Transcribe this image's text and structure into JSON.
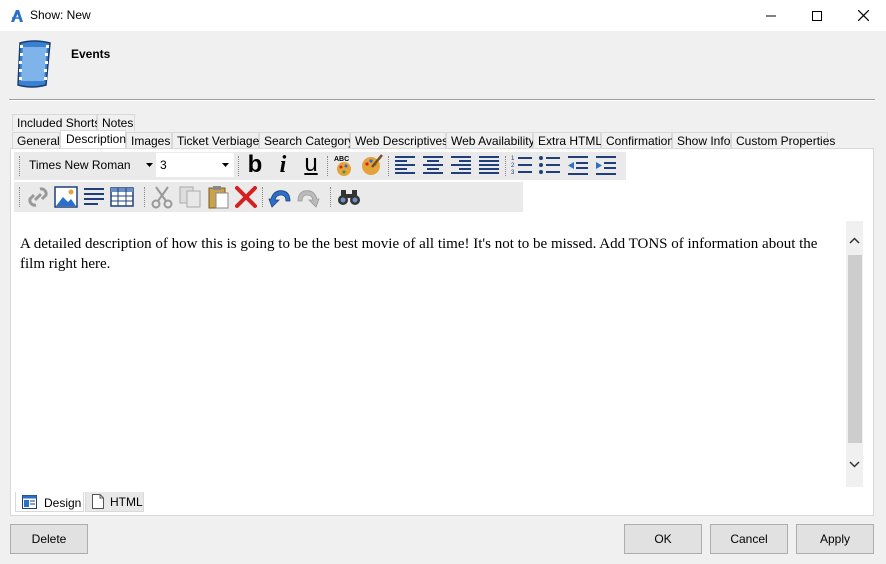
{
  "window": {
    "title": "Show: New"
  },
  "header": {
    "title": "Events"
  },
  "tabs_row1": [
    {
      "label": "Included Shorts"
    },
    {
      "label": "Notes"
    }
  ],
  "tabs_row2": [
    {
      "label": "General"
    },
    {
      "label": "Description"
    },
    {
      "label": "Images"
    },
    {
      "label": "Ticket Verbiage"
    },
    {
      "label": "Search Category"
    },
    {
      "label": "Web Descriptives"
    },
    {
      "label": "Web Availability"
    },
    {
      "label": "Extra HTML"
    },
    {
      "label": "Confirmation"
    },
    {
      "label": "Show Info"
    },
    {
      "label": "Custom Properties"
    }
  ],
  "toolbar": {
    "font_name": "Times New Roman",
    "font_size": "3",
    "bold_label": "b",
    "italic_label": "i",
    "underline_label": "u"
  },
  "editor": {
    "content": "A detailed description of how this is going to be the best movie of all time! It's not to be missed. Add TONS of information about the film right here."
  },
  "editor_tabs": [
    {
      "label": "Design"
    },
    {
      "label": "HTML"
    }
  ],
  "buttons": {
    "delete": "Delete",
    "ok": "OK",
    "cancel": "Cancel",
    "apply": "Apply"
  },
  "colors": {
    "accent": "#2a6fc9",
    "delete_red": "#d42020"
  }
}
